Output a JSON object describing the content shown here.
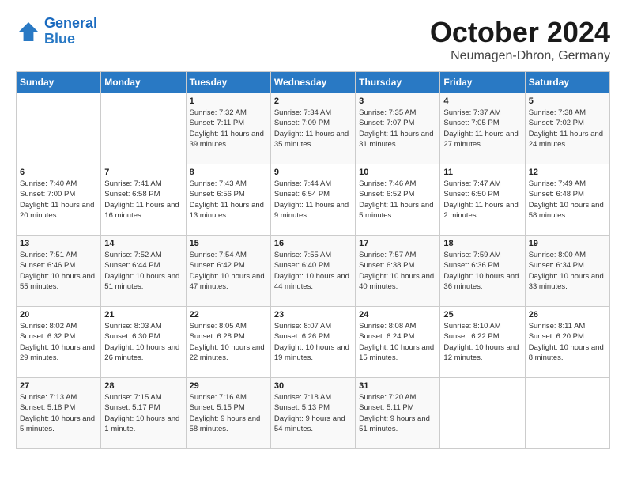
{
  "header": {
    "logo_line1": "General",
    "logo_line2": "Blue",
    "title": "October 2024",
    "subtitle": "Neumagen-Dhron, Germany"
  },
  "days_of_week": [
    "Sunday",
    "Monday",
    "Tuesday",
    "Wednesday",
    "Thursday",
    "Friday",
    "Saturday"
  ],
  "weeks": [
    [
      {
        "day": null
      },
      {
        "day": null
      },
      {
        "day": "1",
        "sunrise": "Sunrise: 7:32 AM",
        "sunset": "Sunset: 7:11 PM",
        "daylight": "Daylight: 11 hours and 39 minutes."
      },
      {
        "day": "2",
        "sunrise": "Sunrise: 7:34 AM",
        "sunset": "Sunset: 7:09 PM",
        "daylight": "Daylight: 11 hours and 35 minutes."
      },
      {
        "day": "3",
        "sunrise": "Sunrise: 7:35 AM",
        "sunset": "Sunset: 7:07 PM",
        "daylight": "Daylight: 11 hours and 31 minutes."
      },
      {
        "day": "4",
        "sunrise": "Sunrise: 7:37 AM",
        "sunset": "Sunset: 7:05 PM",
        "daylight": "Daylight: 11 hours and 27 minutes."
      },
      {
        "day": "5",
        "sunrise": "Sunrise: 7:38 AM",
        "sunset": "Sunset: 7:02 PM",
        "daylight": "Daylight: 11 hours and 24 minutes."
      }
    ],
    [
      {
        "day": "6",
        "sunrise": "Sunrise: 7:40 AM",
        "sunset": "Sunset: 7:00 PM",
        "daylight": "Daylight: 11 hours and 20 minutes."
      },
      {
        "day": "7",
        "sunrise": "Sunrise: 7:41 AM",
        "sunset": "Sunset: 6:58 PM",
        "daylight": "Daylight: 11 hours and 16 minutes."
      },
      {
        "day": "8",
        "sunrise": "Sunrise: 7:43 AM",
        "sunset": "Sunset: 6:56 PM",
        "daylight": "Daylight: 11 hours and 13 minutes."
      },
      {
        "day": "9",
        "sunrise": "Sunrise: 7:44 AM",
        "sunset": "Sunset: 6:54 PM",
        "daylight": "Daylight: 11 hours and 9 minutes."
      },
      {
        "day": "10",
        "sunrise": "Sunrise: 7:46 AM",
        "sunset": "Sunset: 6:52 PM",
        "daylight": "Daylight: 11 hours and 5 minutes."
      },
      {
        "day": "11",
        "sunrise": "Sunrise: 7:47 AM",
        "sunset": "Sunset: 6:50 PM",
        "daylight": "Daylight: 11 hours and 2 minutes."
      },
      {
        "day": "12",
        "sunrise": "Sunrise: 7:49 AM",
        "sunset": "Sunset: 6:48 PM",
        "daylight": "Daylight: 10 hours and 58 minutes."
      }
    ],
    [
      {
        "day": "13",
        "sunrise": "Sunrise: 7:51 AM",
        "sunset": "Sunset: 6:46 PM",
        "daylight": "Daylight: 10 hours and 55 minutes."
      },
      {
        "day": "14",
        "sunrise": "Sunrise: 7:52 AM",
        "sunset": "Sunset: 6:44 PM",
        "daylight": "Daylight: 10 hours and 51 minutes."
      },
      {
        "day": "15",
        "sunrise": "Sunrise: 7:54 AM",
        "sunset": "Sunset: 6:42 PM",
        "daylight": "Daylight: 10 hours and 47 minutes."
      },
      {
        "day": "16",
        "sunrise": "Sunrise: 7:55 AM",
        "sunset": "Sunset: 6:40 PM",
        "daylight": "Daylight: 10 hours and 44 minutes."
      },
      {
        "day": "17",
        "sunrise": "Sunrise: 7:57 AM",
        "sunset": "Sunset: 6:38 PM",
        "daylight": "Daylight: 10 hours and 40 minutes."
      },
      {
        "day": "18",
        "sunrise": "Sunrise: 7:59 AM",
        "sunset": "Sunset: 6:36 PM",
        "daylight": "Daylight: 10 hours and 36 minutes."
      },
      {
        "day": "19",
        "sunrise": "Sunrise: 8:00 AM",
        "sunset": "Sunset: 6:34 PM",
        "daylight": "Daylight: 10 hours and 33 minutes."
      }
    ],
    [
      {
        "day": "20",
        "sunrise": "Sunrise: 8:02 AM",
        "sunset": "Sunset: 6:32 PM",
        "daylight": "Daylight: 10 hours and 29 minutes."
      },
      {
        "day": "21",
        "sunrise": "Sunrise: 8:03 AM",
        "sunset": "Sunset: 6:30 PM",
        "daylight": "Daylight: 10 hours and 26 minutes."
      },
      {
        "day": "22",
        "sunrise": "Sunrise: 8:05 AM",
        "sunset": "Sunset: 6:28 PM",
        "daylight": "Daylight: 10 hours and 22 minutes."
      },
      {
        "day": "23",
        "sunrise": "Sunrise: 8:07 AM",
        "sunset": "Sunset: 6:26 PM",
        "daylight": "Daylight: 10 hours and 19 minutes."
      },
      {
        "day": "24",
        "sunrise": "Sunrise: 8:08 AM",
        "sunset": "Sunset: 6:24 PM",
        "daylight": "Daylight: 10 hours and 15 minutes."
      },
      {
        "day": "25",
        "sunrise": "Sunrise: 8:10 AM",
        "sunset": "Sunset: 6:22 PM",
        "daylight": "Daylight: 10 hours and 12 minutes."
      },
      {
        "day": "26",
        "sunrise": "Sunrise: 8:11 AM",
        "sunset": "Sunset: 6:20 PM",
        "daylight": "Daylight: 10 hours and 8 minutes."
      }
    ],
    [
      {
        "day": "27",
        "sunrise": "Sunrise: 7:13 AM",
        "sunset": "Sunset: 5:18 PM",
        "daylight": "Daylight: 10 hours and 5 minutes."
      },
      {
        "day": "28",
        "sunrise": "Sunrise: 7:15 AM",
        "sunset": "Sunset: 5:17 PM",
        "daylight": "Daylight: 10 hours and 1 minute."
      },
      {
        "day": "29",
        "sunrise": "Sunrise: 7:16 AM",
        "sunset": "Sunset: 5:15 PM",
        "daylight": "Daylight: 9 hours and 58 minutes."
      },
      {
        "day": "30",
        "sunrise": "Sunrise: 7:18 AM",
        "sunset": "Sunset: 5:13 PM",
        "daylight": "Daylight: 9 hours and 54 minutes."
      },
      {
        "day": "31",
        "sunrise": "Sunrise: 7:20 AM",
        "sunset": "Sunset: 5:11 PM",
        "daylight": "Daylight: 9 hours and 51 minutes."
      },
      {
        "day": null
      },
      {
        "day": null
      }
    ]
  ]
}
